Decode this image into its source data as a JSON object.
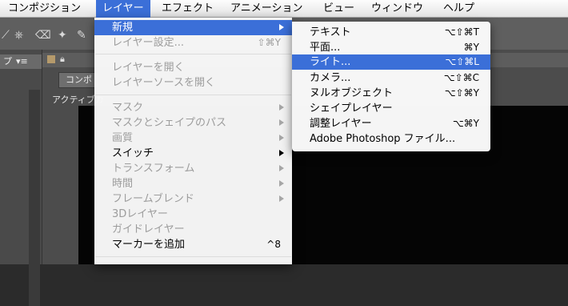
{
  "menubar": {
    "items": [
      {
        "label": "コンポジション",
        "active": false
      },
      {
        "label": "レイヤー",
        "active": true
      },
      {
        "label": "エフェクト",
        "active": false
      },
      {
        "label": "アニメーション",
        "active": false
      },
      {
        "label": "ビュー",
        "active": false
      },
      {
        "label": "ウィンドウ",
        "active": false
      },
      {
        "label": "ヘルプ",
        "active": false
      }
    ]
  },
  "background": {
    "left_panel_tab": "プ",
    "comp_tab": "コンポ",
    "viewer_label": "アクティブカ"
  },
  "layer_menu": {
    "items": [
      {
        "label": "新規",
        "shortcut": "",
        "submenu": true,
        "disabled": false,
        "highlighted": true
      },
      {
        "label": "レイヤー設定...",
        "shortcut": "⇧⌘Y",
        "submenu": false,
        "disabled": true
      },
      {
        "label": "レイヤーを開く",
        "shortcut": "",
        "submenu": false,
        "disabled": true
      },
      {
        "label": "レイヤーソースを開く",
        "shortcut": "",
        "submenu": false,
        "disabled": true
      },
      {
        "label": "マスク",
        "shortcut": "",
        "submenu": true,
        "disabled": true
      },
      {
        "label": "マスクとシェイプのパス",
        "shortcut": "",
        "submenu": true,
        "disabled": true
      },
      {
        "label": "画質",
        "shortcut": "",
        "submenu": true,
        "disabled": true
      },
      {
        "label": "スイッチ",
        "shortcut": "",
        "submenu": true,
        "disabled": false
      },
      {
        "label": "トランスフォーム",
        "shortcut": "",
        "submenu": true,
        "disabled": true
      },
      {
        "label": "時間",
        "shortcut": "",
        "submenu": true,
        "disabled": true
      },
      {
        "label": "フレームブレンド",
        "shortcut": "",
        "submenu": true,
        "disabled": true
      },
      {
        "label": "3Dレイヤー",
        "shortcut": "",
        "submenu": false,
        "disabled": true
      },
      {
        "label": "ガイドレイヤー",
        "shortcut": "",
        "submenu": false,
        "disabled": true
      },
      {
        "label": "マーカーを追加",
        "shortcut": "^8",
        "submenu": false,
        "disabled": false
      }
    ]
  },
  "new_submenu": {
    "items": [
      {
        "label": "テキスト",
        "shortcut": "⌥⇧⌘T",
        "highlighted": false
      },
      {
        "label": "平面...",
        "shortcut": "⌘Y",
        "highlighted": false
      },
      {
        "label": "ライト...",
        "shortcut": "⌥⇧⌘L",
        "highlighted": true
      },
      {
        "label": "カメラ...",
        "shortcut": "⌥⇧⌘C",
        "highlighted": false
      },
      {
        "label": "ヌルオブジェクト",
        "shortcut": "⌥⇧⌘Y",
        "highlighted": false
      },
      {
        "label": "シェイプレイヤー",
        "shortcut": "",
        "highlighted": false
      },
      {
        "label": "調整レイヤー",
        "shortcut": "⌥⌘Y",
        "highlighted": false
      },
      {
        "label": "Adobe Photoshop ファイル...",
        "shortcut": "",
        "highlighted": false
      }
    ]
  },
  "colors": {
    "highlight": "#3b6fd8",
    "disabled_text": "#9c9c9c",
    "viewer_bg": "#050505"
  }
}
